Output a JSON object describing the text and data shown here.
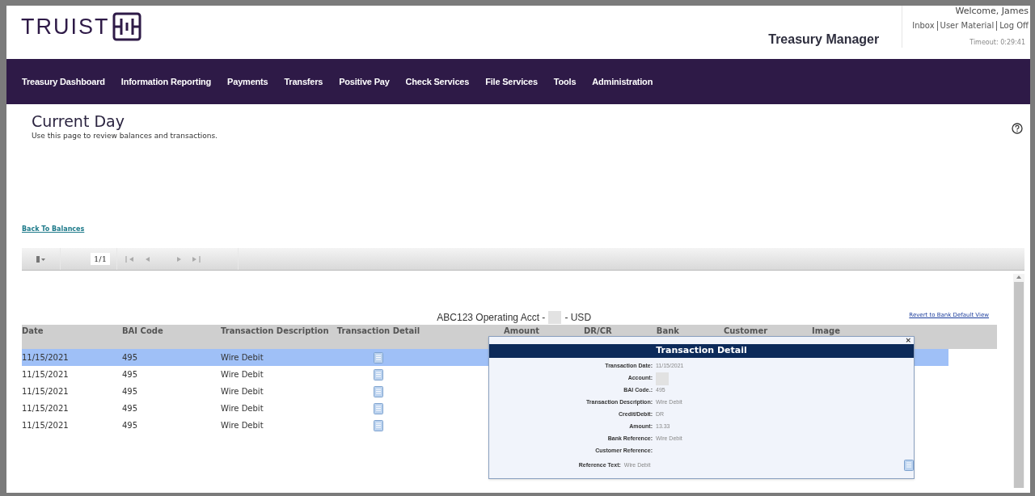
{
  "header": {
    "logo": "TRUIST",
    "app_title": "Treasury Manager",
    "welcome": "Welcome, James",
    "links": [
      "Inbox",
      "User Material",
      "Log Off"
    ],
    "timeout": "Timeout: 0:29:41"
  },
  "nav": [
    "Treasury Dashboard",
    "Information Reporting",
    "Payments",
    "Transfers",
    "Positive Pay",
    "Check Services",
    "File Services",
    "Tools",
    "Administration"
  ],
  "page": {
    "title": "Current Day",
    "subtitle": "Use this page to review balances and transactions.",
    "back_link": "Back To Balances"
  },
  "toolbar": {
    "page": "1/1"
  },
  "account": {
    "prefix": "ABC123 Operating Acct -",
    "suffix": "- USD",
    "revert_link": "Revert to Bank Default View"
  },
  "table": {
    "columns": [
      "Date",
      "BAI Code",
      "Transaction Description",
      "Transaction Detail",
      "Amount",
      "DR/CR",
      "Bank",
      "Customer",
      "Image"
    ],
    "rows": [
      {
        "date": "11/15/2021",
        "bai_code": "495",
        "description": "Wire Debit",
        "selected": true
      },
      {
        "date": "11/15/2021",
        "bai_code": "495",
        "description": "Wire Debit",
        "selected": false
      },
      {
        "date": "11/15/2021",
        "bai_code": "495",
        "description": "Wire Debit",
        "selected": false
      },
      {
        "date": "11/15/2021",
        "bai_code": "495",
        "description": "Wire Debit",
        "selected": false
      },
      {
        "date": "11/15/2021",
        "bai_code": "495",
        "description": "Wire Debit",
        "selected": false
      }
    ]
  },
  "popup": {
    "title": "Transaction Detail",
    "close": "×",
    "fields": [
      {
        "label": "Transaction Date:",
        "value": "11/15/2021"
      },
      {
        "label": "Account:",
        "kind": "redacted"
      },
      {
        "label": "BAI Code.:",
        "value": "495"
      },
      {
        "label": "Transaction Description:",
        "value": "Wire Debit"
      },
      {
        "label": "Credit/Debit:",
        "value": "DR"
      },
      {
        "label": "Amount:",
        "value": "13.33"
      },
      {
        "label": "Bank Reference:",
        "value": "Wire Debit"
      },
      {
        "label": "Customer Reference:"
      },
      {
        "label": "Reference Text:",
        "value": "Wire Debit",
        "kind": "document"
      }
    ]
  }
}
